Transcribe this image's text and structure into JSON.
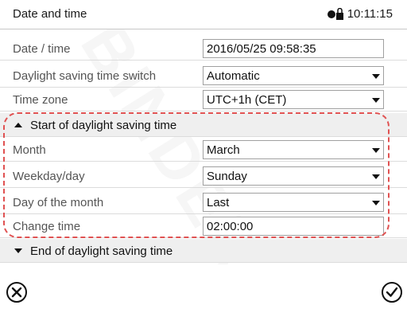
{
  "header": {
    "title": "Date and time",
    "time": "10:11:15"
  },
  "rows": [
    {
      "label": "Date / time",
      "value": "2016/05/25 09:58:35",
      "dropdown": false
    },
    {
      "label": "Daylight saving time switch",
      "value": "Automatic",
      "dropdown": true
    },
    {
      "label": "Time zone",
      "value": "UTC+1h (CET)",
      "dropdown": true
    }
  ],
  "start_section": {
    "label": "Start of daylight saving time",
    "expanded": true
  },
  "start_rows": [
    {
      "label": "Month",
      "value": "March",
      "dropdown": true
    },
    {
      "label": "Weekday/day",
      "value": "Sunday",
      "dropdown": true
    },
    {
      "label": "Day of the month",
      "value": "Last",
      "dropdown": true
    },
    {
      "label": "Change time",
      "value": "02:00:00",
      "dropdown": false
    }
  ],
  "end_section": {
    "label": "End of daylight saving time",
    "expanded": false
  },
  "colors": {
    "highlight": "#e05252",
    "section_bg": "#efefef"
  },
  "footer": {
    "cancel_icon": "close-circle-icon",
    "confirm_icon": "check-circle-icon"
  }
}
